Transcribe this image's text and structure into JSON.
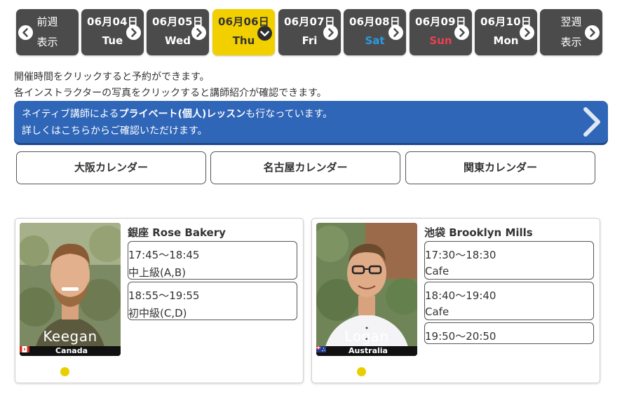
{
  "nav": {
    "prev": {
      "top": "前週",
      "bottom": "表示"
    },
    "next": {
      "top": "翌週",
      "bottom": "表示"
    },
    "days": [
      {
        "date": "06月04日",
        "weekday": "Tue",
        "kind": "weekday",
        "active": false
      },
      {
        "date": "06月05日",
        "weekday": "Wed",
        "kind": "weekday",
        "active": false
      },
      {
        "date": "06月06日",
        "weekday": "Thu",
        "kind": "weekday",
        "active": true
      },
      {
        "date": "06月07日",
        "weekday": "Fri",
        "kind": "weekday",
        "active": false
      },
      {
        "date": "06月08日",
        "weekday": "Sat",
        "kind": "sat",
        "active": false
      },
      {
        "date": "06月09日",
        "weekday": "Sun",
        "kind": "sun",
        "active": false
      },
      {
        "date": "06月10日",
        "weekday": "Mon",
        "kind": "weekday",
        "active": false
      }
    ]
  },
  "notices": {
    "line1": "開催時間をクリックすると予約ができます。",
    "line2": "各インストラクターの写真をクリックすると講師紹介が確認できます。"
  },
  "banner": {
    "line1_prefix": "ネイティブ講師による",
    "line1_bold": "プライベート(個人)レッスン",
    "line1_suffix": "も行なっています。",
    "line2": "詳しくはこちらからご確認いただけます。"
  },
  "regions": [
    "大阪カレンダー",
    "名古屋カレンダー",
    "関東カレンダー"
  ],
  "instructors": [
    {
      "name": "Keegan",
      "country": "Canada",
      "school": "銀座 Rose Bakery",
      "slots": [
        {
          "time": "17:45〜18:45",
          "level": "中上級(A,B)"
        },
        {
          "time": "18:55〜19:55",
          "level": "初中級(C,D)"
        }
      ]
    },
    {
      "name": "Logan",
      "country": "Australia",
      "school": "池袋 Brooklyn Mills",
      "slots": [
        {
          "time": "17:30〜18:30",
          "level": "Cafe"
        },
        {
          "time": "18:40〜19:40",
          "level": "Cafe"
        },
        {
          "time": "19:50〜20:50",
          "level": ""
        }
      ]
    }
  ],
  "colors": {
    "nav_bg": "#4b4b4b",
    "nav_active": "#f2d000",
    "saturday": "#2b9be5",
    "sunday": "#e8424e",
    "banner": "#2f66b8",
    "dot": "#e9cf00"
  },
  "icons": {
    "prev": "chevron-left-circle-icon",
    "next": "chevron-right-circle-icon",
    "active_day": "chevron-down-circle-icon",
    "banner": "chevron-right-icon"
  }
}
